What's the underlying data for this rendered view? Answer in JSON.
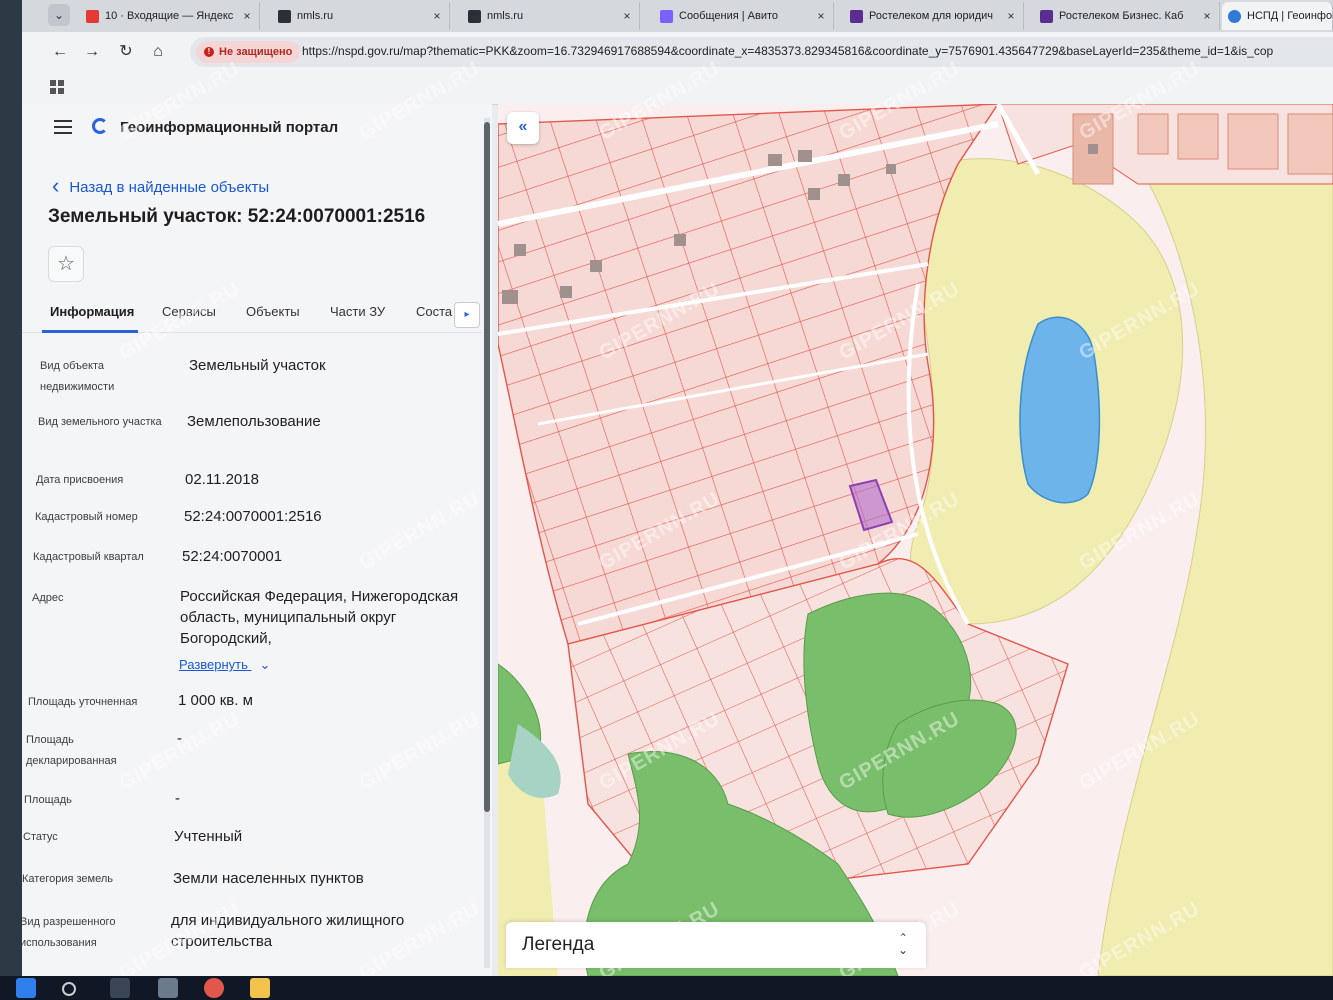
{
  "browser": {
    "tabs": [
      {
        "title": "10 · Входящие — Яндекс",
        "color": "#e53935",
        "active": false
      },
      {
        "title": "nmls.ru",
        "color": "#2b2f36",
        "active": false
      },
      {
        "title": "nmls.ru",
        "color": "#2b2f36",
        "active": false
      },
      {
        "title": "Сообщения | Авито",
        "color": "#7b61ff",
        "active": false
      },
      {
        "title": "Ростелеком для юридич",
        "color": "#5b2d90",
        "active": false
      },
      {
        "title": "Ростелеком Бизнес. Каб",
        "color": "#5b2d90",
        "active": false
      },
      {
        "title": "НСПД | Геоинфор",
        "color": "#2e7bd6",
        "active": true
      }
    ],
    "close_glyph": "×",
    "menu_glyph": "⌄",
    "security_label": "Не защищено",
    "url": "https://nspd.gov.ru/map?thematic=PKK&zoom=16.732946917688594&coordinate_x=4835373.829345816&coordinate_y=7576901.435647729&baseLayerId=235&theme_id=1&is_cop",
    "nav": {
      "back": "←",
      "forward": "→",
      "reload": "↻",
      "home": "⌂"
    }
  },
  "panel": {
    "portal_title": "Геоинформационный портал",
    "back_link": "Назад в найденные объекты",
    "back_glyph": "‹",
    "object_title": "Земельный участок: 52:24:0070001:2516",
    "star_glyph": "☆",
    "tabs": [
      "Информация",
      "Сервисы",
      "Объекты",
      "Части ЗУ",
      "Соста"
    ],
    "tabs_arrow": "▸",
    "fields": [
      {
        "label": "Вид объекта недвижимости",
        "value": "Земельный участок"
      },
      {
        "label": "Вид земельного участка",
        "value": "Землепользование"
      },
      {
        "label": "Дата присвоения",
        "value": "02.11.2018"
      },
      {
        "label": "Кадастровый номер",
        "value": "52:24:0070001:2516"
      },
      {
        "label": "Кадастровый квартал",
        "value": "52:24:0070001"
      },
      {
        "label": "Адрес",
        "value": "Российская Федерация, Нижегородская область, муниципальный округ Богородский,"
      },
      {
        "label": "Площадь уточненная",
        "value": "1 000 кв. м"
      },
      {
        "label": "Площадь декларированная",
        "value": "-"
      },
      {
        "label": "Площадь",
        "value": "-"
      },
      {
        "label": "Статус",
        "value": "Учтенный"
      },
      {
        "label": "Категория земель",
        "value": "Земли населенных пунктов"
      },
      {
        "label": "Вид разрешенного использования",
        "value": "для индивидуального жилищного строительства"
      }
    ],
    "expand_label": "Развернуть",
    "expand_glyph": "⌄"
  },
  "map": {
    "collapse_glyph": "«",
    "legend_title": "Легенда",
    "legend_glyph_up": "⌃",
    "legend_glyph_down": "⌄",
    "colors": {
      "background": "#fbeeee",
      "parcel_fill": "#f6d9d5",
      "parcel_line": "#e2574c",
      "field": "#f1ecb0",
      "water": "#6cb4ea",
      "forest": "#79be6a",
      "road": "#ffffff",
      "building": "#a0908e",
      "selected": "#b36bcf"
    }
  },
  "watermark": "GIPERNN.RU"
}
